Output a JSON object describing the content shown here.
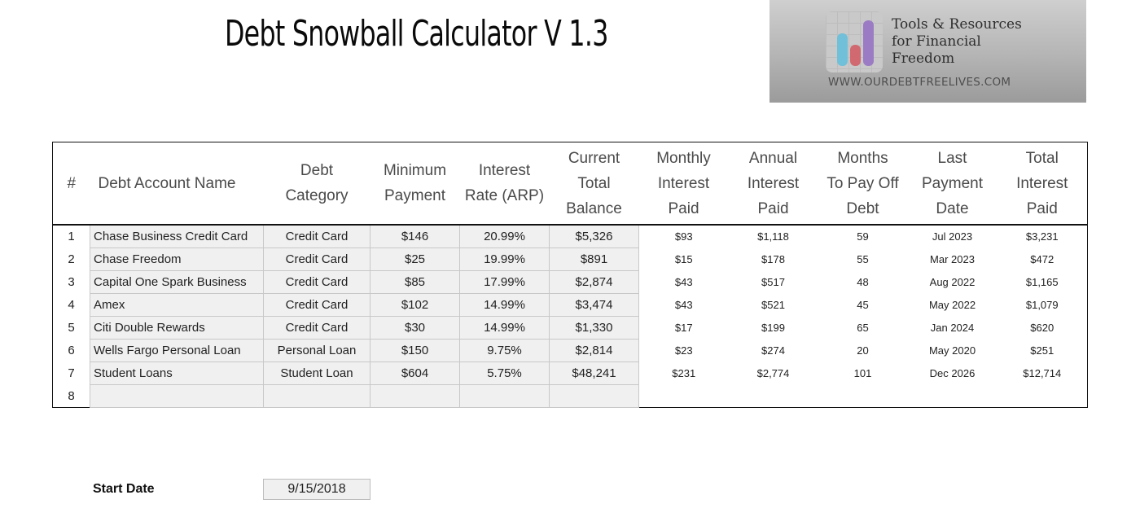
{
  "title": "Debt Snowball Calculator V 1.3",
  "banner": {
    "tagline_lines": [
      "Tools & Resources",
      "for Financial",
      "Freedom"
    ],
    "url": "WWW.OURDEBTFREELIVES.COM",
    "logo_icon": "bar-chart-icon",
    "colors": {
      "bar1": "#6fc0d8",
      "bar2": "#d06a70",
      "bar3": "#9b7cc4"
    }
  },
  "table": {
    "headers": [
      [
        "#"
      ],
      [
        "Debt Account Name"
      ],
      [
        "Debt",
        "Category"
      ],
      [
        "Minimum",
        "Payment"
      ],
      [
        "Interest",
        "Rate (ARP)"
      ],
      [
        "Current",
        "Total",
        "Balance"
      ],
      [
        "Monthly",
        "Interest",
        "Paid"
      ],
      [
        "Annual",
        "Interest",
        "Paid"
      ],
      [
        "Months",
        "To Pay Off",
        "Debt"
      ],
      [
        "Last",
        "Payment",
        "Date"
      ],
      [
        "Total",
        "Interest",
        "Paid"
      ]
    ],
    "rows": [
      {
        "n": "1",
        "name": "Chase Business Credit Card",
        "category": "Credit Card",
        "min_payment": "$146",
        "rate": "20.99%",
        "balance": "$5,326",
        "monthly_interest": "$93",
        "annual_interest": "$1,118",
        "months": "59",
        "last_date": "Jul 2023",
        "total_interest": "$3,231"
      },
      {
        "n": "2",
        "name": "Chase Freedom",
        "category": "Credit Card",
        "min_payment": "$25",
        "rate": "19.99%",
        "balance": "$891",
        "monthly_interest": "$15",
        "annual_interest": "$178",
        "months": "55",
        "last_date": "Mar 2023",
        "total_interest": "$472"
      },
      {
        "n": "3",
        "name": "Capital One Spark Business",
        "category": "Credit Card",
        "min_payment": "$85",
        "rate": "17.99%",
        "balance": "$2,874",
        "monthly_interest": "$43",
        "annual_interest": "$517",
        "months": "48",
        "last_date": "Aug 2022",
        "total_interest": "$1,165"
      },
      {
        "n": "4",
        "name": "Amex",
        "category": "Credit Card",
        "min_payment": "$102",
        "rate": "14.99%",
        "balance": "$3,474",
        "monthly_interest": "$43",
        "annual_interest": "$521",
        "months": "45",
        "last_date": "May 2022",
        "total_interest": "$1,079"
      },
      {
        "n": "5",
        "name": "Citi Double Rewards",
        "category": "Credit Card",
        "min_payment": "$30",
        "rate": "14.99%",
        "balance": "$1,330",
        "monthly_interest": "$17",
        "annual_interest": "$199",
        "months": "65",
        "last_date": "Jan 2024",
        "total_interest": "$620"
      },
      {
        "n": "6",
        "name": "Wells Fargo Personal Loan",
        "category": "Personal Loan",
        "min_payment": "$150",
        "rate": "9.75%",
        "balance": "$2,814",
        "monthly_interest": "$23",
        "annual_interest": "$274",
        "months": "20",
        "last_date": "May 2020",
        "total_interest": "$251"
      },
      {
        "n": "7",
        "name": "Student Loans",
        "category": "Student Loan",
        "min_payment": "$604",
        "rate": "5.75%",
        "balance": "$48,241",
        "monthly_interest": "$231",
        "annual_interest": "$2,774",
        "months": "101",
        "last_date": "Dec 2026",
        "total_interest": "$12,714"
      },
      {
        "n": "8",
        "name": "",
        "category": "",
        "min_payment": "",
        "rate": "",
        "balance": "",
        "monthly_interest": "",
        "annual_interest": "",
        "months": "",
        "last_date": "",
        "total_interest": ""
      }
    ]
  },
  "start_date": {
    "label": "Start Date",
    "value": "9/15/2018"
  }
}
